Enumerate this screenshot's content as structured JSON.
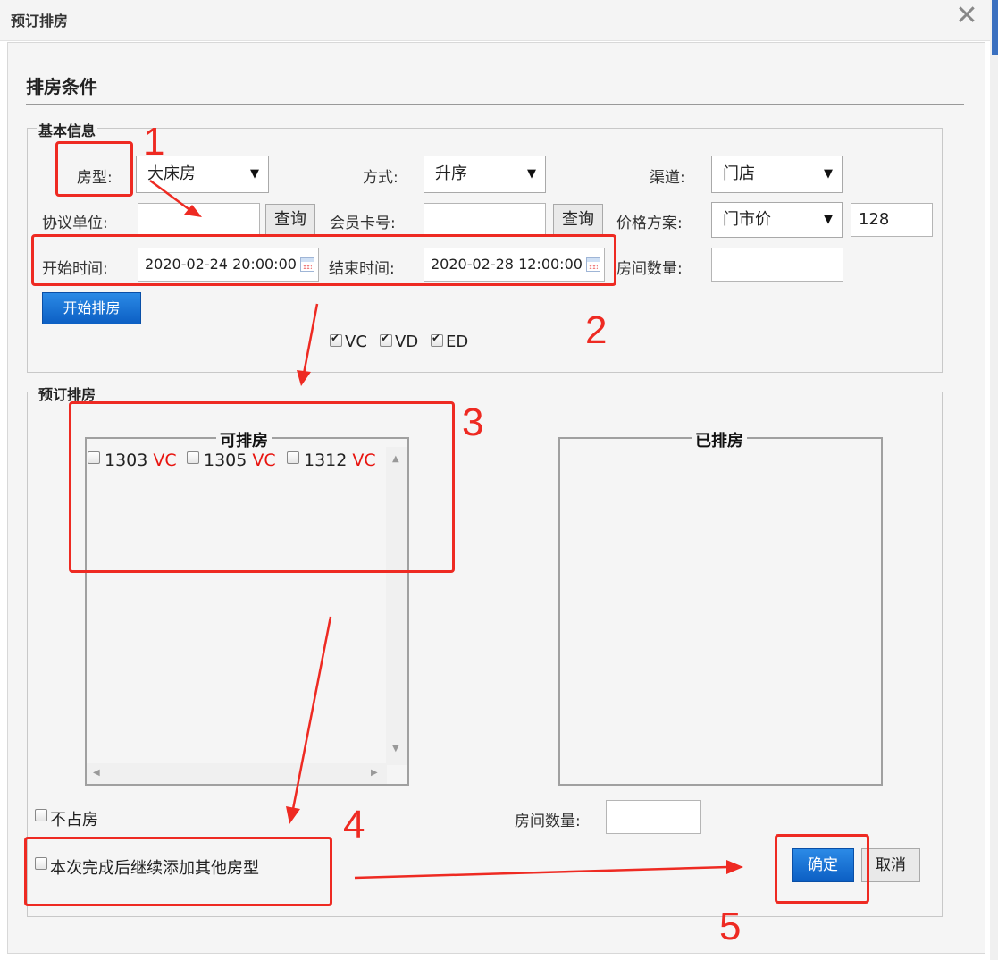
{
  "window": {
    "title": "预订排房",
    "close_icon": "close-icon"
  },
  "section_title": "排房条件",
  "basic": {
    "legend": "基本信息",
    "room_type_label": "房型:",
    "room_type_value": "大床房",
    "method_label": "方式:",
    "method_value": "升序",
    "channel_label": "渠道:",
    "channel_value": "门店",
    "agreement_label": "协议单位:",
    "agreement_value": "",
    "query_btn": "查询",
    "member_label": "会员卡号:",
    "member_value": "",
    "query_btn2": "查询",
    "price_plan_label": "价格方案:",
    "price_plan_value": "门市价",
    "price_value": "128",
    "start_label": "开始时间:",
    "start_value": "2020-02-24 20:00:00",
    "end_label": "结束时间:",
    "end_value": "2020-02-28 12:00:00",
    "room_count_label": "房间数量:",
    "room_count_value": "",
    "start_btn": "开始排房",
    "filters": [
      {
        "label": "VC",
        "checked": true
      },
      {
        "label": "VD",
        "checked": true
      },
      {
        "label": "ED",
        "checked": true
      }
    ]
  },
  "booking": {
    "legend": "预订排房",
    "available_title": "可排房",
    "assigned_title": "已排房",
    "rooms": [
      {
        "number": "1303",
        "status": "VC"
      },
      {
        "number": "1305",
        "status": "VC"
      },
      {
        "number": "1312",
        "status": "VC"
      }
    ],
    "no_occupy_label": "不占房",
    "continue_label": "本次完成后继续添加其他房型",
    "room_count_label": "房间数量:",
    "room_count_value": "",
    "confirm_btn": "确定",
    "cancel_btn": "取消"
  },
  "annotations": [
    "1",
    "2",
    "3",
    "4",
    "5"
  ],
  "colors": {
    "annotation": "#ee2a22",
    "primary_button": "#0c5fc4",
    "status_text": "#e8140f"
  }
}
